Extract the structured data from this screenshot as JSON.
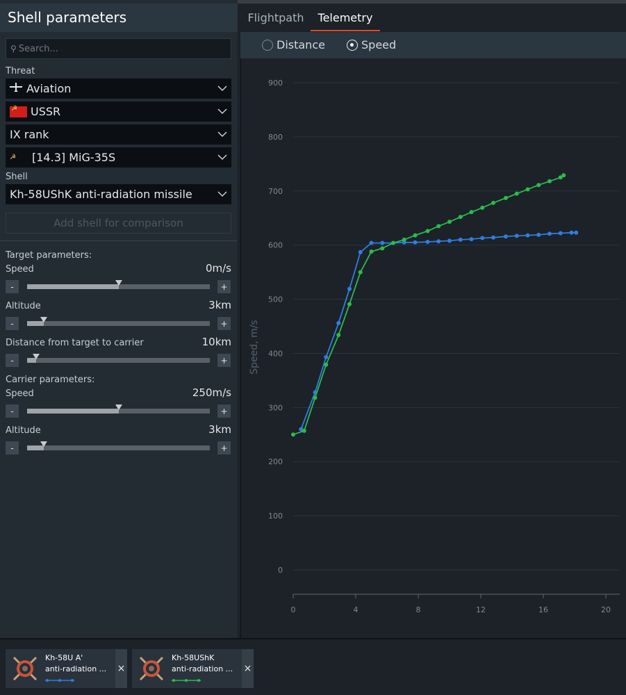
{
  "left_panel": {
    "title": "Shell parameters",
    "search_placeholder": "Search...",
    "threat_label": "Threat",
    "threat_type": "Aviation",
    "country": "USSR",
    "rank": "IX rank",
    "vehicle": "[14.3] MiG-35S",
    "shell_label": "Shell",
    "shell": "Kh-58UShK anti-radiation missile",
    "add_shell": "Add shell for comparison",
    "target_params_label": "Target parameters:",
    "carrier_params_label": "Carrier parameters:",
    "minus": "-",
    "plus": "+",
    "sliders": [
      {
        "label": "Speed",
        "value": "0m/s",
        "level": 0.5
      },
      {
        "label": "Altitude",
        "value": "3km",
        "level": 0.09
      },
      {
        "label": "Distance from target to carrier",
        "value": "10km",
        "level": 0.05
      },
      {
        "label": "Speed",
        "value": "250m/s",
        "level": 0.5
      },
      {
        "label": "Altitude",
        "value": "3km",
        "level": 0.09
      }
    ]
  },
  "tabs": [
    {
      "label": "Flightpath",
      "active": false
    },
    {
      "label": "Telemetry",
      "active": true
    }
  ],
  "mode_options": [
    {
      "label": "Distance",
      "selected": false
    },
    {
      "label": "Speed",
      "selected": true
    }
  ],
  "chart_data": {
    "type": "line",
    "ylabel": "Speed, m/s",
    "xlabel": "",
    "xlim": [
      0,
      20
    ],
    "ylim": [
      0,
      900
    ],
    "x_ticks": [
      0,
      4,
      8,
      12,
      16,
      20
    ],
    "y_ticks": [
      0,
      100,
      200,
      300,
      400,
      500,
      600,
      700,
      800,
      900
    ],
    "grid": true,
    "series": [
      {
        "color": "#2f7de2",
        "points": [
          [
            0.5,
            260
          ],
          [
            1.4,
            328
          ],
          [
            2.1,
            393
          ],
          [
            2.9,
            456
          ],
          [
            3.6,
            519
          ],
          [
            4.3,
            587
          ],
          [
            5.0,
            604
          ],
          [
            5.7,
            604
          ],
          [
            6.4,
            604
          ],
          [
            7.1,
            605
          ],
          [
            7.8,
            605
          ],
          [
            8.6,
            606
          ],
          [
            9.3,
            607
          ],
          [
            10.0,
            608
          ],
          [
            10.7,
            610
          ],
          [
            11.4,
            611
          ],
          [
            12.1,
            613
          ],
          [
            12.8,
            614
          ],
          [
            13.6,
            616
          ],
          [
            14.3,
            617
          ],
          [
            15.0,
            618
          ],
          [
            15.7,
            619
          ],
          [
            16.4,
            621
          ],
          [
            17.1,
            622
          ],
          [
            17.8,
            623
          ],
          [
            18.1,
            623
          ]
        ]
      },
      {
        "color": "#2cbb4c",
        "points": [
          [
            0,
            250
          ],
          [
            0.7,
            257
          ],
          [
            1.4,
            318
          ],
          [
            2.1,
            379
          ],
          [
            2.9,
            434
          ],
          [
            3.6,
            491
          ],
          [
            4.3,
            550
          ],
          [
            5.0,
            588
          ],
          [
            5.7,
            594
          ],
          [
            6.4,
            604
          ],
          [
            7.1,
            610
          ],
          [
            7.8,
            618
          ],
          [
            8.6,
            626
          ],
          [
            9.3,
            635
          ],
          [
            10.0,
            643
          ],
          [
            10.7,
            652
          ],
          [
            11.4,
            661
          ],
          [
            12.1,
            669
          ],
          [
            12.8,
            678
          ],
          [
            13.6,
            687
          ],
          [
            14.3,
            695
          ],
          [
            15.0,
            703
          ],
          [
            15.7,
            711
          ],
          [
            16.4,
            718
          ],
          [
            17.1,
            725
          ],
          [
            17.3,
            729
          ]
        ]
      }
    ]
  },
  "comparison_cards": [
    {
      "name": "Kh-58U A'",
      "desc": "anti-radiation ...",
      "color": "#2f7de2",
      "close": "×"
    },
    {
      "name": "Kh-58UShK",
      "desc": "anti-radiation ...",
      "color": "#2cbb4c",
      "close": "×"
    }
  ]
}
